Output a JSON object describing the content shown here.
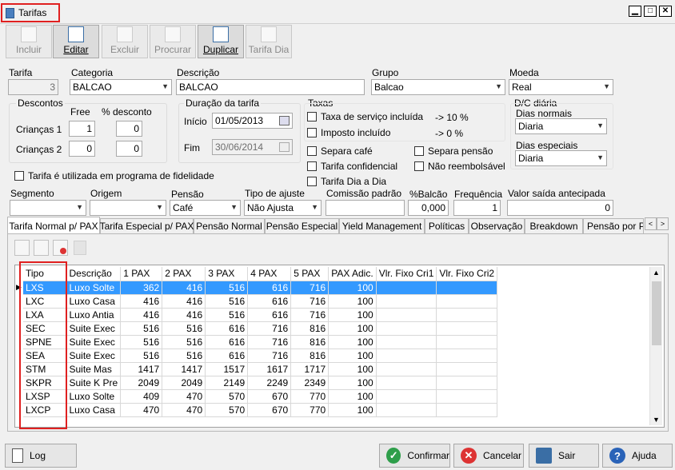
{
  "window": {
    "title": "Tarifas"
  },
  "toolbar": {
    "buttons": [
      "Incluir",
      "Editar",
      "Excluir",
      "Procurar",
      "Duplicar",
      "Tarifa Dia"
    ]
  },
  "form": {
    "tarifa_label": "Tarifa",
    "tarifa_value": "3",
    "categoria_label": "Categoria",
    "categoria_value": "BALCAO",
    "descricao_label": "Descrição",
    "descricao_value": "BALCAO",
    "grupo_label": "Grupo",
    "grupo_value": "Balcao",
    "moeda_label": "Moeda",
    "moeda_value": "Real",
    "descontos": {
      "title": "Descontos",
      "free_label": "Free",
      "pct_label": "% desconto",
      "criancas1_label": "Crianças 1",
      "criancas1_free": "1",
      "criancas1_pct": "0",
      "criancas2_label": "Crianças 2",
      "criancas2_free": "0",
      "criancas2_pct": "0"
    },
    "duracao": {
      "title": "Duração da tarifa",
      "inicio_label": "Início",
      "inicio_value": "01/05/2013",
      "fim_label": "Fim",
      "fim_value": "30/06/2014"
    },
    "taxas": {
      "title": "Taxas",
      "servico_label": "Taxa de serviço incluída",
      "servico_pct": "-> 10 %",
      "imposto_label": "Imposto incluído",
      "imposto_pct": "-> 0 %"
    },
    "dc": {
      "title": "D/C diária",
      "normais_label": "Dias normais",
      "normais_value": "Diaria",
      "especiais_label": "Dias especiais",
      "especiais_value": "Diaria"
    },
    "checks": {
      "separa_cafe": "Separa café",
      "separa_pensao": "Separa pensão",
      "confidencial": "Tarifa confidencial",
      "nao_reembolsavel": "Não reembolsável",
      "tarifa_dia": "Tarifa Dia a Dia",
      "fidelidade": "Tarifa é utilizada em programa de fidelidade"
    },
    "row2": {
      "segmento_label": "Segmento",
      "origem_label": "Origem",
      "pensao_label": "Pensão",
      "pensao_value": "Café",
      "tipo_ajuste_label": "Tipo de ajuste",
      "tipo_ajuste_value": "Não Ajusta",
      "comissao_label": "Comissão padrão",
      "balcao_label": "%Balcão",
      "balcao_value": "0,000",
      "frequencia_label": "Frequência",
      "frequencia_value": "1",
      "valor_saida_label": "Valor saída antecipada",
      "valor_saida_value": "0"
    }
  },
  "tabs": [
    "Tarifa Normal p/ PAX",
    "Tarifa Especial p/ PAX",
    "Pensão Normal",
    "Pensão Especial",
    "Yield Management",
    "Políticas",
    "Observação",
    "Breakdown",
    "Pensão por PA"
  ],
  "grid": {
    "columns": [
      "Tipo",
      "Descrição",
      "1 PAX",
      "2 PAX",
      "3 PAX",
      "4 PAX",
      "5 PAX",
      "PAX Adic.",
      "Vlr. Fixo Cri1",
      "Vlr. Fixo Cri2"
    ],
    "rows": [
      [
        "LXS",
        "Luxo Solte",
        "362",
        "416",
        "516",
        "616",
        "716",
        "100"
      ],
      [
        "LXC",
        "Luxo Casa",
        "416",
        "416",
        "516",
        "616",
        "716",
        "100"
      ],
      [
        "LXA",
        "Luxo Antia",
        "416",
        "416",
        "516",
        "616",
        "716",
        "100"
      ],
      [
        "SEC",
        "Suite Exec",
        "516",
        "516",
        "616",
        "716",
        "816",
        "100"
      ],
      [
        "SPNE",
        "Suite Exec",
        "516",
        "516",
        "616",
        "716",
        "816",
        "100"
      ],
      [
        "SEA",
        "Suite Exec",
        "516",
        "516",
        "616",
        "716",
        "816",
        "100"
      ],
      [
        "STM",
        "Suite Mas",
        "1417",
        "1417",
        "1517",
        "1617",
        "1717",
        "100"
      ],
      [
        "SKPR",
        "Suite K Pre",
        "2049",
        "2049",
        "2149",
        "2249",
        "2349",
        "100"
      ],
      [
        "LXSP",
        "Luxo Solte",
        "409",
        "470",
        "570",
        "670",
        "770",
        "100"
      ],
      [
        "LXCP",
        "Luxo Casa",
        "470",
        "470",
        "570",
        "670",
        "770",
        "100"
      ]
    ]
  },
  "bottom": {
    "log": "Log",
    "confirmar": "Confirmar",
    "cancelar": "Cancelar",
    "sair": "Sair",
    "ajuda": "Ajuda"
  },
  "colors": {
    "selection": "#3399ff",
    "highlight": "#e02020"
  }
}
